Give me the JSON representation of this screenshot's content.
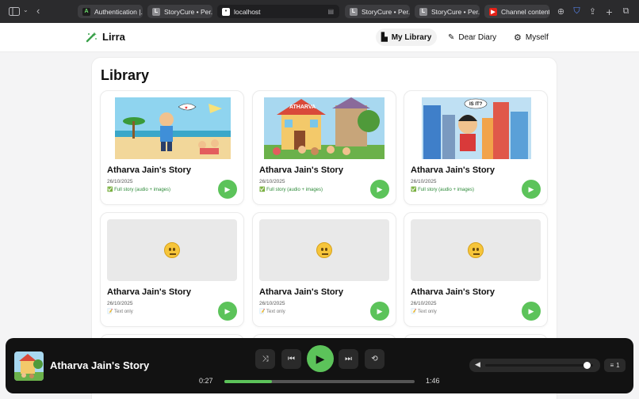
{
  "browser": {
    "tabs": [
      {
        "label": "Authentication |...",
        "favicon": "A"
      },
      {
        "label": "StoryCure • Per...",
        "favicon": "L"
      },
      {
        "label": "localhost",
        "favicon": "•"
      },
      {
        "label": "StoryCure • Per...",
        "favicon": "L"
      },
      {
        "label": "StoryCure • Per...",
        "favicon": "L"
      },
      {
        "label": "Channel content...",
        "favicon": "▶"
      }
    ]
  },
  "app": {
    "brand": "Lirra",
    "nav": [
      {
        "label": "My Library",
        "icon": "library-icon",
        "selected": true
      },
      {
        "label": "Dear Diary",
        "icon": "pen-icon",
        "selected": false
      },
      {
        "label": "Myself",
        "icon": "gear-icon",
        "selected": false
      }
    ]
  },
  "library": {
    "title": "Library",
    "cards": [
      {
        "title": "Atharva Jain's Story",
        "date": "26/10/2025",
        "type": "✅ Full story (audio + images)",
        "art": "beach"
      },
      {
        "title": "Atharva Jain's Story",
        "date": "26/10/2025",
        "type": "✅ Full story (audio + images)",
        "art": "house"
      },
      {
        "title": "Atharva Jain's Story",
        "date": "26/10/2025",
        "type": "✅ Full story (audio + images)",
        "art": "city"
      },
      {
        "title": "Atharva Jain's Story",
        "date": "26/10/2025",
        "type": "📝 Text only",
        "art": "none"
      },
      {
        "title": "Atharva Jain's Story",
        "date": "26/10/2025",
        "type": "📝 Text only",
        "art": "none"
      },
      {
        "title": "Atharva Jain's Story",
        "date": "26/10/2025",
        "type": "📝 Text only",
        "art": "none"
      }
    ]
  },
  "player": {
    "title": "Atharva Jain's Story",
    "elapsed": "0:27",
    "duration": "1:46",
    "progress": 0.25,
    "volume": 0.95,
    "queue_count": "1",
    "accent": "#5cc35a"
  }
}
